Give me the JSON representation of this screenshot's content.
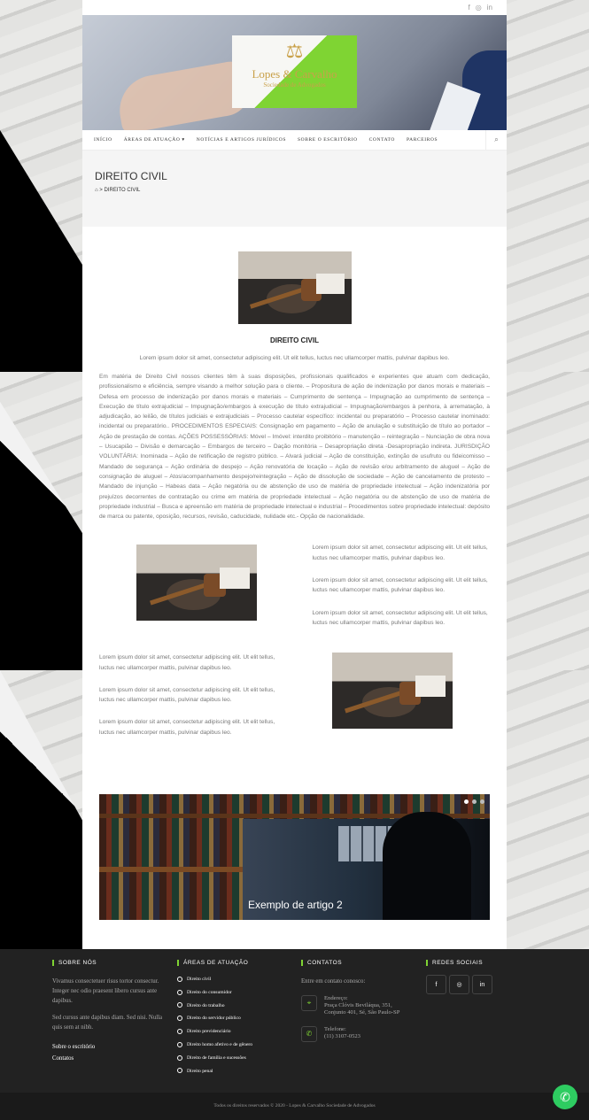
{
  "topbar": {
    "icons": [
      "facebook-icon",
      "instagram-icon",
      "linkedin-icon"
    ],
    "facebook": "f",
    "instagram": "◎",
    "linkedin": "in"
  },
  "logo": {
    "symbol": "⚖",
    "name": "Lopes & Carvalho",
    "tagline": "Sociedade de Advogados"
  },
  "nav": {
    "items": [
      "INÍCIO",
      "ÁREAS DE ATUAÇÃO ▾",
      "NOTÍCIAS E ARTIGOS JURÍDICOS",
      "SOBRE O ESCRITÓRIO",
      "CONTATO",
      "PARCEIROS"
    ],
    "search_icon": "⌕"
  },
  "page_title": "DIREITO CIVIL",
  "breadcrumb": {
    "home_icon": "⌂",
    "separator": ">",
    "current": "DIREITO CIVIL"
  },
  "article": {
    "title": "DIREITO CIVIL",
    "lead": "Lorem ipsum dolor sit amet, consectetur adipiscing elit. Ut elit tellus, luctus nec ullamcorper mattis, pulvinar dapibus leo.",
    "body": "Em matéria de Direito Civil nossos clientes têm à suas disposições, profissionais qualificados e experientes que atuam com dedicação, profissionalismo e eficiência, sempre visando a melhor solução para o cliente. – Propositura de ação de indenização por danos morais e materiais – Defesa em processo de indenização por danos morais e materiais – Cumprimento de sentença – Impugnação ao cumprimento de sentença – Execução de título extrajudicial – Impugnação/embargos à execução de título extrajudicial – Impugnação/embargos à penhora, à arrematação, à adjudicação, ao leilão, de títulos judiciais e extrajudiciais – Processo cautelar específico: incidental ou preparatório – Processo cautelar inominado: incidental ou preparatório.. PROCEDIMENTOS ESPECIAIS: Consignação em pagamento – Ação de anulação e substituição de título ao portador – Ação de prestação de contas. AÇÕES POSSESSÓRIAS: Móvel – Imóvel: interdito proibitório – manutenção – reintegração – Nunciação de obra nova – Usucapião – Divisão e demarcação – Embargos de terceiro – Dação monitória – Desapropriação direta -Desapropriação indireta. JURISDIÇÃO VOLUNTÁRIA: Inominada – Ação de retificação de registro público. – Alvará judicial – Ação de constituição, extinção de usufruto ou fideicomisso – Mandado de segurança – Ação ordinária de despejo – Ação renovatória de locação – Ação de revisão e/ou arbitramento de aluguel – Ação de consignação de aluguel – Atos/acompanhamento despejo/reintegração – Ação de dissolução de sociedade – Ação de cancelamento de protesto – Mandado de injunção – Habeas data – Ação negatória ou de abstenção de uso de matéria de propriedade intelectual – Ação indenizatória por prejuízos decorrentes de contratação ou crime em matéria de propriedade intelectual – Ação negatória ou de abstenção de uso de matéria de propriedade industrial – Busca e apreensão em matéria de propriedade intelectual e industrial – Procedimentos sobre propriedade intelectual: depósito de marca ou patente, oposição, recursos, revisão, caducidade, nulidade etc.- Opção de nacionalidade.",
    "row1": [
      "Lorem ipsum dolor sit amet, consectetur adipiscing elit. Ut elit tellus, luctus nec ullamcorper mattis, pulvinar dapibus leo.",
      "Lorem ipsum dolor sit amet, consectetur adipiscing elit. Ut elit tellus, luctus nec ullamcorper mattis, pulvinar dapibus leo.",
      "Lorem ipsum dolor sit amet, consectetur adipiscing elit. Ut elit tellus, luctus nec ullamcorper mattis, pulvinar dapibus leo."
    ],
    "row2": [
      "Lorem ipsum dolor sit amet, consectetur adipiscing elit. Ut elit tellus, luctus nec ullamcorper mattis, pulvinar dapibus leo.",
      "Lorem ipsum dolor sit amet, consectetur adipiscing elit. Ut elit tellus, luctus nec ullamcorper mattis, pulvinar dapibus leo.",
      "Lorem ipsum dolor sit amet, consectetur adipiscing elit. Ut elit tellus, luctus nec ullamcorper mattis, pulvinar dapibus leo."
    ]
  },
  "slider": {
    "caption": "Exemplo de artigo 2",
    "active_slide": 1
  },
  "footer": {
    "about": {
      "heading": "SOBRE NÓS",
      "text1": "Vivamus consectetuer risus tortor consectur. Integer nec odio praesent libero cursus ante dapibus.",
      "text2": "Sed cursus ante dapibus diam. Sed nisi. Nulla quis sem at nibh.",
      "link1": "Sobre o escritório",
      "link2": "Contatos"
    },
    "areas": {
      "heading": "ÁREAS DE ATUAÇÃO",
      "items": [
        "Direito civil",
        "Direito do consumidor",
        "Direito do trabalho",
        "Direito do servidor público",
        "Direito previdenciário",
        "Direito homo afetivo e de gênero",
        "Direito de família e sucessões",
        "Direito penal"
      ]
    },
    "contacts": {
      "heading": "CONTATOS",
      "intro": "Entre em contato conosco:",
      "address_label": "Endereço:",
      "address_line1": "Praça Clóvis Beviláqua, 351,",
      "address_line2": "Conjunto 401, Sé, São Paulo-SP",
      "phone_label": "Telefone:",
      "phone": "(11) 3107-0523",
      "pin_icon": "⌖",
      "phone_icon": "✆"
    },
    "social": {
      "heading": "REDES SOCIAIS",
      "facebook": "f",
      "instagram": "◎",
      "linkedin": "in"
    },
    "copyright": "Todos os direitos reservados © 2020 - Lopes & Carvalho Sociedade de Advogados"
  },
  "whatsapp": {
    "icon": "✆"
  },
  "colors": {
    "accent": "#7fd433",
    "footer_bg": "#222222",
    "whatsapp": "#2ecc61"
  }
}
